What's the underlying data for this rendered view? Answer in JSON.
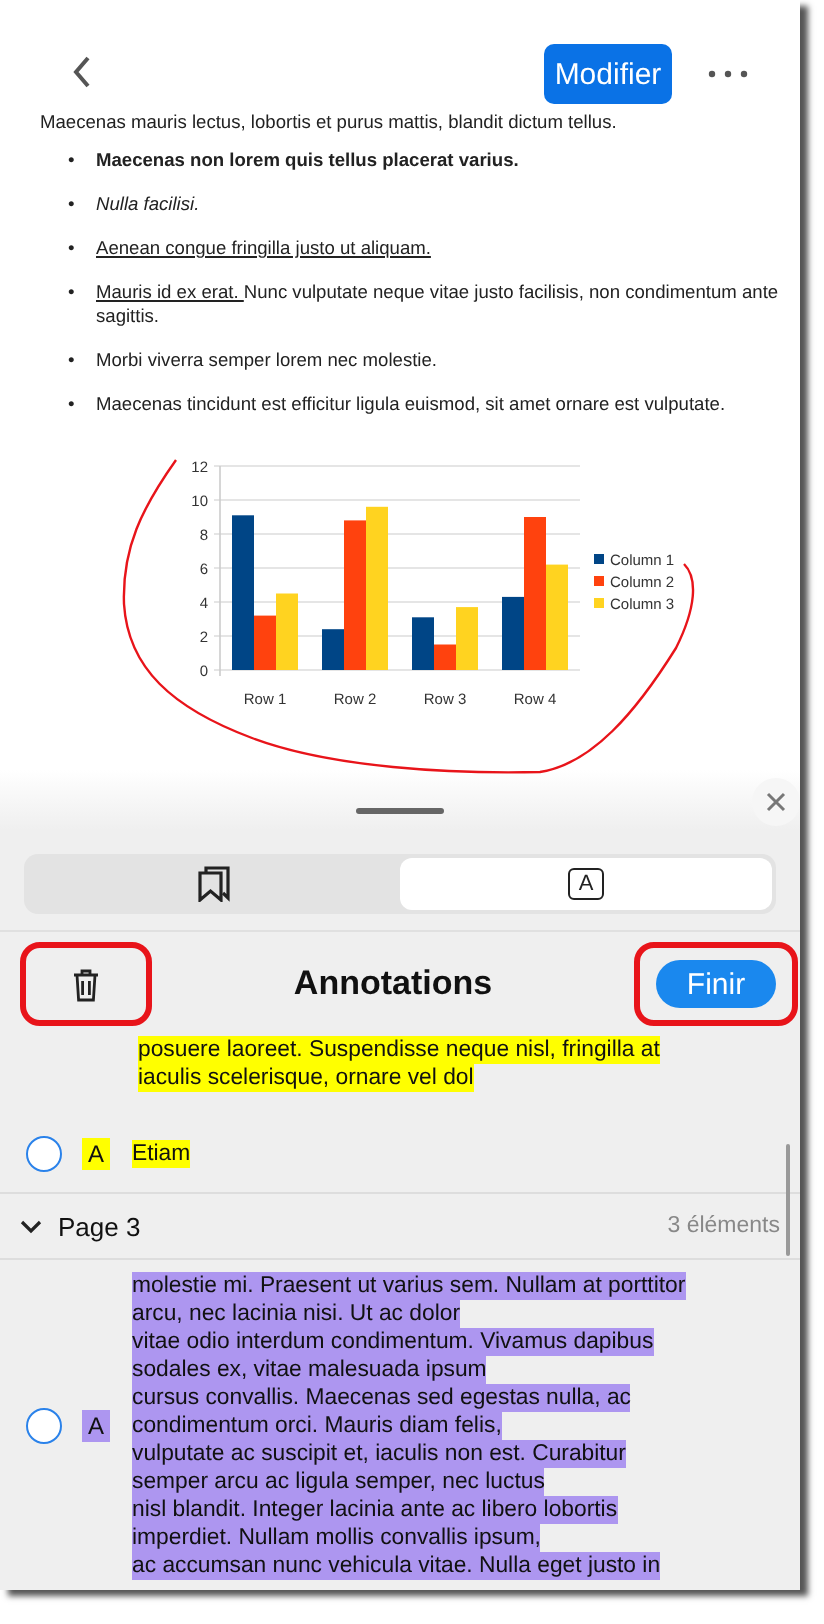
{
  "top_bar": {
    "edit_button": "Modifier"
  },
  "document": {
    "intro": "Maecenas mauris lectus, lobortis et purus mattis, blandit dictum tellus.",
    "bullets": [
      {
        "kind": "bold",
        "marker": "•",
        "text": "Maecenas non lorem quis tellus placerat varius."
      },
      {
        "kind": "italic",
        "marker": "•",
        "text": "Nulla facilisi."
      },
      {
        "kind": "underlined",
        "marker": "•",
        "text": "Aenean congue fringilla justo ut aliquam. "
      },
      {
        "kind": "plain",
        "marker": "•",
        "underlined_lead": "Mauris id ex erat. ",
        "text": "Nunc vulputate neque vitae justo facilisis, non condimentum ante sagittis."
      },
      {
        "kind": "plain",
        "marker": "•",
        "text": "Morbi viverra semper lorem nec molestie."
      },
      {
        "kind": "plain",
        "marker": "•",
        "text": "Maecenas tincidunt est efficitur ligula euismod, sit amet ornare est vulputate."
      }
    ],
    "chart_data": {
      "type": "bar",
      "categories": [
        "Row 1",
        "Row 2",
        "Row 3",
        "Row 4"
      ],
      "ylim": [
        0,
        12
      ],
      "yticks": [
        0,
        2,
        4,
        6,
        8,
        10,
        12
      ],
      "grid": true,
      "legend": true,
      "series": [
        {
          "name": "Column 1",
          "color": "#004586",
          "values": [
            9.1,
            2.4,
            3.1,
            4.3
          ]
        },
        {
          "name": "Column 2",
          "color": "#ff420e",
          "values": [
            3.2,
            8.8,
            1.5,
            9.0
          ]
        },
        {
          "name": "Column 3",
          "color": "#ffd320",
          "values": [
            4.5,
            9.6,
            3.7,
            6.2
          ]
        }
      ]
    }
  },
  "panel": {
    "tabs": [
      {
        "kind": "bookmarks",
        "selected": false
      },
      {
        "kind": "annotations",
        "label": "A",
        "selected": true
      }
    ],
    "title": "Annotations",
    "done_button": "Finir",
    "items": [
      {
        "kind": "continuation",
        "color": "#ffff00",
        "lines": [
          "posuere laoreet. Suspendisse neque nisl, fringilla at",
          "iaculis scelerisque, ornare vel dol"
        ]
      },
      {
        "kind": "annotation",
        "color": "#ffff00",
        "marker": "A",
        "lines": [
          "Etiam"
        ],
        "selected": false
      }
    ],
    "sections": [
      {
        "title": "Page 3",
        "count": "3 éléments",
        "expanded": true,
        "items": [
          {
            "kind": "annotation",
            "color": "#ad96f0",
            "marker": "A",
            "selected": false,
            "lines": [
              "molestie mi. Praesent ut varius sem. Nullam at porttitor",
              "arcu, nec lacinia nisi. Ut ac dolor",
              "vitae odio interdum condimentum. Vivamus dapibus",
              "sodales ex, vitae malesuada ipsum",
              "cursus convallis. Maecenas sed egestas nulla, ac",
              "condimentum orci. Mauris diam felis,",
              "vulputate ac suscipit et, iaculis non est. Curabitur",
              "semper arcu ac ligula semper, nec luctus",
              "nisl blandit. Integer lacinia ante ac libero lobortis",
              "imperdiet. Nullam mollis convallis ipsum,",
              "ac accumsan nunc vehicula vitae. Nulla eget justo in"
            ]
          }
        ]
      }
    ]
  }
}
